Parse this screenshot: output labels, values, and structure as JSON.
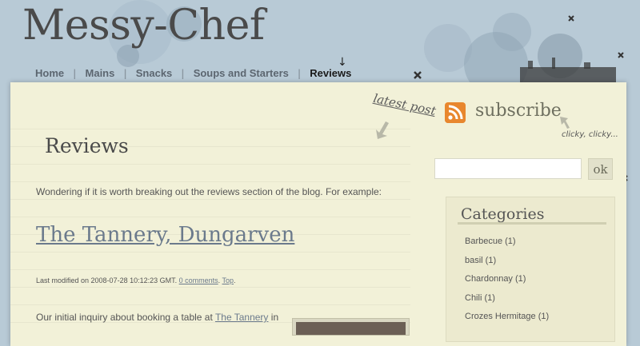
{
  "site": {
    "title": "Messy-Chef"
  },
  "nav": {
    "items": [
      {
        "label": "Home"
      },
      {
        "label": "Mains"
      },
      {
        "label": "Snacks"
      },
      {
        "label": "Soups and Starters"
      },
      {
        "label": "Reviews",
        "active": true
      }
    ]
  },
  "promo": {
    "latest_post": "latest post",
    "subscribe": "subscribe",
    "clicky": "clicky, clicky..."
  },
  "page": {
    "heading": "Reviews",
    "intro": "Wondering if it is worth breaking out the reviews section of the blog. For example:"
  },
  "post": {
    "title": "The Tannery, Dungarven",
    "meta_prefix": "Last modified on 2008-07-28 10:12:23 GMT.",
    "comments_link": "0 comments",
    "top_link": "Top",
    "body_prefix": "Our initial inquiry about booking a table at",
    "body_link": "The Tannery",
    "body_suffix": "in"
  },
  "search": {
    "value": "",
    "button_label": "ok"
  },
  "categories": {
    "title": "Categories",
    "items": [
      {
        "label": "Barbecue (1)"
      },
      {
        "label": "basil (1)"
      },
      {
        "label": "Chardonnay (1)"
      },
      {
        "label": "Chili (1)"
      },
      {
        "label": "Crozes Hermitage (1)"
      }
    ]
  },
  "colors": {
    "background": "#b8cad6",
    "paper": "#f2f1d8",
    "link": "#6b7a8c",
    "rss": "#e8872e"
  }
}
